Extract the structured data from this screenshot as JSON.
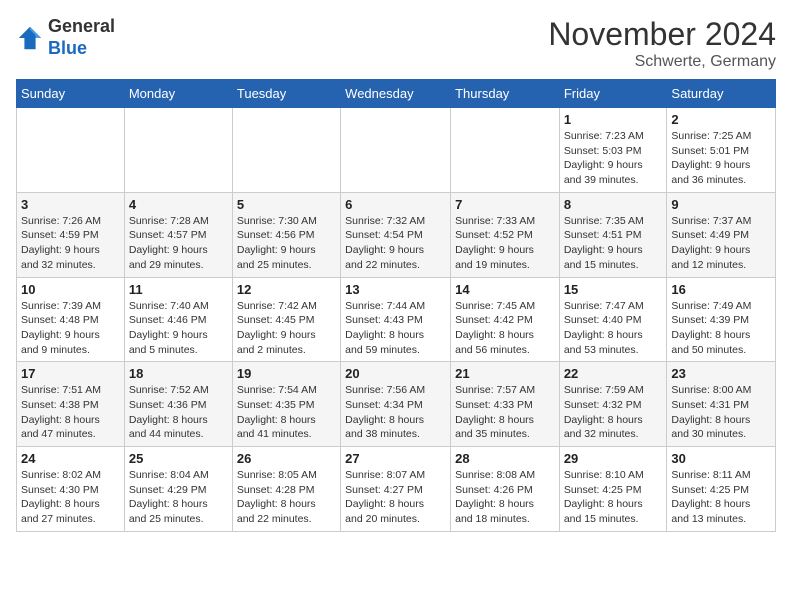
{
  "header": {
    "logo_general": "General",
    "logo_blue": "Blue",
    "month_title": "November 2024",
    "location": "Schwerte, Germany"
  },
  "days_of_week": [
    "Sunday",
    "Monday",
    "Tuesday",
    "Wednesday",
    "Thursday",
    "Friday",
    "Saturday"
  ],
  "weeks": [
    [
      {
        "day": "",
        "info": ""
      },
      {
        "day": "",
        "info": ""
      },
      {
        "day": "",
        "info": ""
      },
      {
        "day": "",
        "info": ""
      },
      {
        "day": "",
        "info": ""
      },
      {
        "day": "1",
        "info": "Sunrise: 7:23 AM\nSunset: 5:03 PM\nDaylight: 9 hours\nand 39 minutes."
      },
      {
        "day": "2",
        "info": "Sunrise: 7:25 AM\nSunset: 5:01 PM\nDaylight: 9 hours\nand 36 minutes."
      }
    ],
    [
      {
        "day": "3",
        "info": "Sunrise: 7:26 AM\nSunset: 4:59 PM\nDaylight: 9 hours\nand 32 minutes."
      },
      {
        "day": "4",
        "info": "Sunrise: 7:28 AM\nSunset: 4:57 PM\nDaylight: 9 hours\nand 29 minutes."
      },
      {
        "day": "5",
        "info": "Sunrise: 7:30 AM\nSunset: 4:56 PM\nDaylight: 9 hours\nand 25 minutes."
      },
      {
        "day": "6",
        "info": "Sunrise: 7:32 AM\nSunset: 4:54 PM\nDaylight: 9 hours\nand 22 minutes."
      },
      {
        "day": "7",
        "info": "Sunrise: 7:33 AM\nSunset: 4:52 PM\nDaylight: 9 hours\nand 19 minutes."
      },
      {
        "day": "8",
        "info": "Sunrise: 7:35 AM\nSunset: 4:51 PM\nDaylight: 9 hours\nand 15 minutes."
      },
      {
        "day": "9",
        "info": "Sunrise: 7:37 AM\nSunset: 4:49 PM\nDaylight: 9 hours\nand 12 minutes."
      }
    ],
    [
      {
        "day": "10",
        "info": "Sunrise: 7:39 AM\nSunset: 4:48 PM\nDaylight: 9 hours\nand 9 minutes."
      },
      {
        "day": "11",
        "info": "Sunrise: 7:40 AM\nSunset: 4:46 PM\nDaylight: 9 hours\nand 5 minutes."
      },
      {
        "day": "12",
        "info": "Sunrise: 7:42 AM\nSunset: 4:45 PM\nDaylight: 9 hours\nand 2 minutes."
      },
      {
        "day": "13",
        "info": "Sunrise: 7:44 AM\nSunset: 4:43 PM\nDaylight: 8 hours\nand 59 minutes."
      },
      {
        "day": "14",
        "info": "Sunrise: 7:45 AM\nSunset: 4:42 PM\nDaylight: 8 hours\nand 56 minutes."
      },
      {
        "day": "15",
        "info": "Sunrise: 7:47 AM\nSunset: 4:40 PM\nDaylight: 8 hours\nand 53 minutes."
      },
      {
        "day": "16",
        "info": "Sunrise: 7:49 AM\nSunset: 4:39 PM\nDaylight: 8 hours\nand 50 minutes."
      }
    ],
    [
      {
        "day": "17",
        "info": "Sunrise: 7:51 AM\nSunset: 4:38 PM\nDaylight: 8 hours\nand 47 minutes."
      },
      {
        "day": "18",
        "info": "Sunrise: 7:52 AM\nSunset: 4:36 PM\nDaylight: 8 hours\nand 44 minutes."
      },
      {
        "day": "19",
        "info": "Sunrise: 7:54 AM\nSunset: 4:35 PM\nDaylight: 8 hours\nand 41 minutes."
      },
      {
        "day": "20",
        "info": "Sunrise: 7:56 AM\nSunset: 4:34 PM\nDaylight: 8 hours\nand 38 minutes."
      },
      {
        "day": "21",
        "info": "Sunrise: 7:57 AM\nSunset: 4:33 PM\nDaylight: 8 hours\nand 35 minutes."
      },
      {
        "day": "22",
        "info": "Sunrise: 7:59 AM\nSunset: 4:32 PM\nDaylight: 8 hours\nand 32 minutes."
      },
      {
        "day": "23",
        "info": "Sunrise: 8:00 AM\nSunset: 4:31 PM\nDaylight: 8 hours\nand 30 minutes."
      }
    ],
    [
      {
        "day": "24",
        "info": "Sunrise: 8:02 AM\nSunset: 4:30 PM\nDaylight: 8 hours\nand 27 minutes."
      },
      {
        "day": "25",
        "info": "Sunrise: 8:04 AM\nSunset: 4:29 PM\nDaylight: 8 hours\nand 25 minutes."
      },
      {
        "day": "26",
        "info": "Sunrise: 8:05 AM\nSunset: 4:28 PM\nDaylight: 8 hours\nand 22 minutes."
      },
      {
        "day": "27",
        "info": "Sunrise: 8:07 AM\nSunset: 4:27 PM\nDaylight: 8 hours\nand 20 minutes."
      },
      {
        "day": "28",
        "info": "Sunrise: 8:08 AM\nSunset: 4:26 PM\nDaylight: 8 hours\nand 18 minutes."
      },
      {
        "day": "29",
        "info": "Sunrise: 8:10 AM\nSunset: 4:25 PM\nDaylight: 8 hours\nand 15 minutes."
      },
      {
        "day": "30",
        "info": "Sunrise: 8:11 AM\nSunset: 4:25 PM\nDaylight: 8 hours\nand 13 minutes."
      }
    ]
  ]
}
